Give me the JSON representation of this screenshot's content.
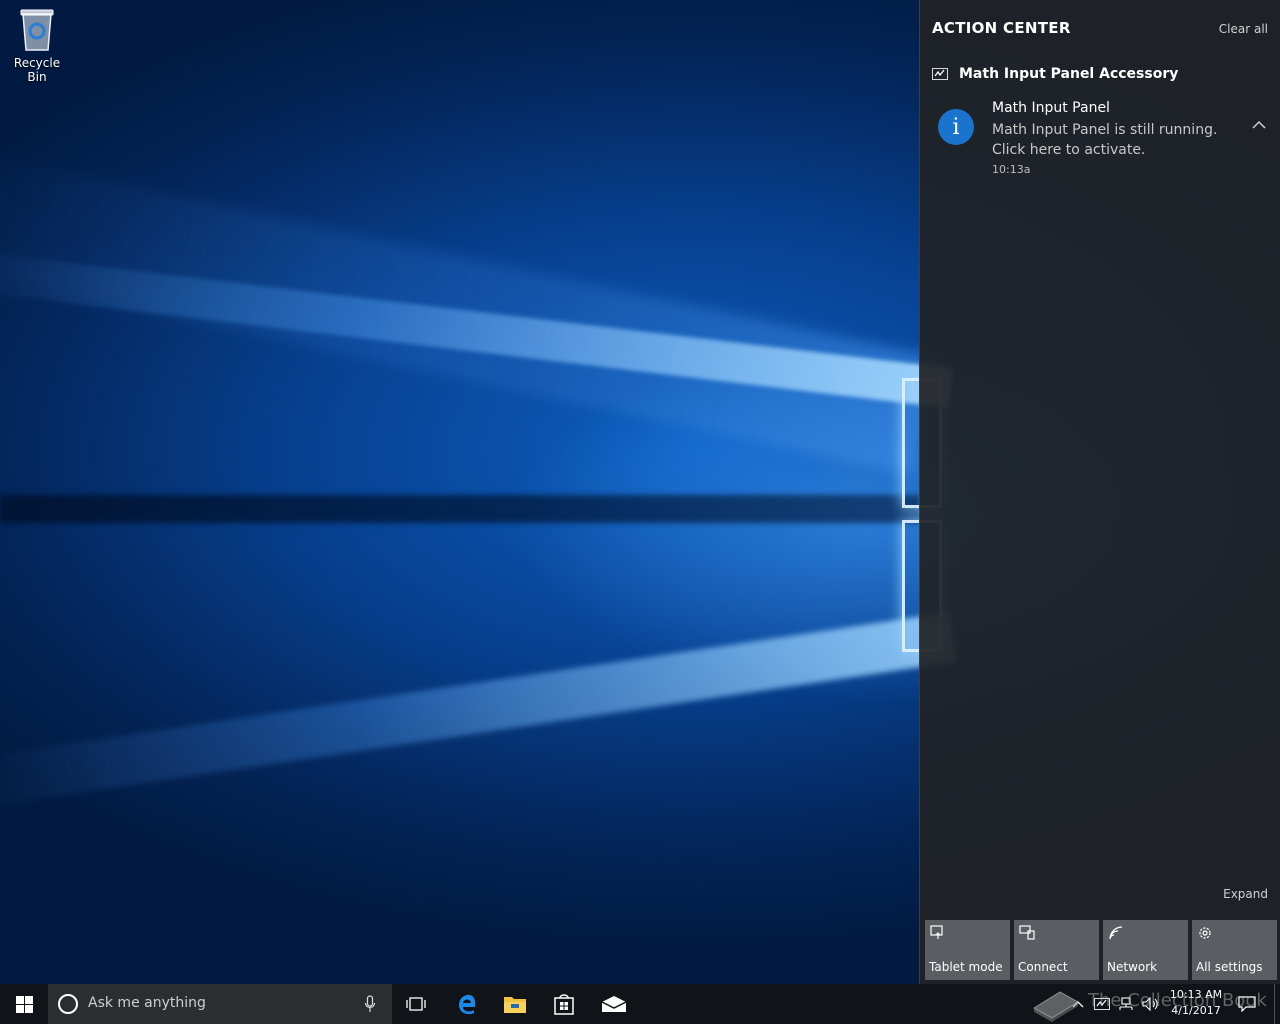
{
  "desktop": {
    "icons": [
      {
        "label": "Recycle Bin",
        "icon": "recycle-bin-icon"
      }
    ]
  },
  "action_center": {
    "title": "ACTION CENTER",
    "clear_all": "Clear all",
    "group": {
      "app_name": "Math Input Panel Accessory",
      "icon": "math-input-panel-icon"
    },
    "notification": {
      "title": "Math Input Panel",
      "body": "Math Input Panel is still running. Click here to activate.",
      "time": "10:13a",
      "icon": "info-icon",
      "icon_color": "#1a73cc"
    },
    "expand": "Expand",
    "quick_actions": [
      {
        "label": "Tablet mode",
        "icon": "tablet-mode-icon"
      },
      {
        "label": "Connect",
        "icon": "connect-icon"
      },
      {
        "label": "Network",
        "icon": "network-icon"
      },
      {
        "label": "All settings",
        "icon": "gear-icon"
      }
    ]
  },
  "taskbar": {
    "search_placeholder": "Ask me anything",
    "pinned": [
      {
        "name": "Task View",
        "icon": "task-view-icon"
      },
      {
        "name": "Microsoft Edge",
        "icon": "edge-icon"
      },
      {
        "name": "File Explorer",
        "icon": "folder-icon"
      },
      {
        "name": "Store",
        "icon": "store-icon"
      },
      {
        "name": "Mail",
        "icon": "mail-icon"
      }
    ],
    "clock": {
      "time": "10:13 AM",
      "date": "4/1/2017"
    },
    "accent": "#1a73cc"
  },
  "watermark": {
    "text": "The Collection Book"
  }
}
